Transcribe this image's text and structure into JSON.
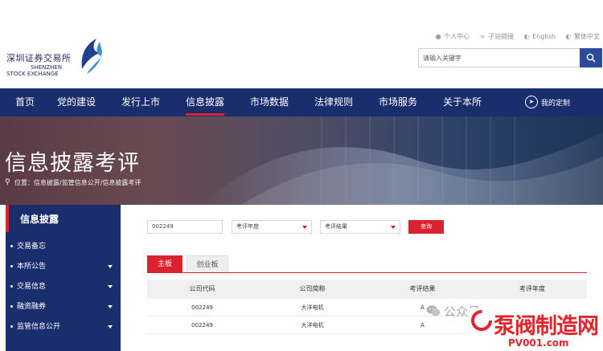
{
  "header": {
    "logo_cn": "深圳证券交易所",
    "logo_en_1": "SHENZHEN",
    "logo_en_2": "STOCK EXCHANGE",
    "toplinks": [
      {
        "label": "个人中心",
        "icon": "user-icon"
      },
      {
        "label": "子站链接",
        "icon": "link-icon"
      },
      {
        "label": "English",
        "icon": "globe-icon"
      },
      {
        "label": "繁体中文",
        "icon": "globe-icon"
      }
    ],
    "search_placeholder": "请输入关键字"
  },
  "nav": {
    "items": [
      "首页",
      "党的建设",
      "发行上市",
      "信息披露",
      "市场数据",
      "法律规则",
      "市场服务",
      "关于本所"
    ],
    "active": "信息披露",
    "custom_label": "我的定制"
  },
  "banner": {
    "title": "信息披露考评",
    "breadcrumb": "位置：信息披露/监管信息公开/信息披露考评"
  },
  "sidebar": {
    "title": "信息披露",
    "items": [
      {
        "label": "交易备忘",
        "has_arrow": false
      },
      {
        "label": "本所公告",
        "has_arrow": true
      },
      {
        "label": "交易信息",
        "has_arrow": true
      },
      {
        "label": "融资融券",
        "has_arrow": true
      },
      {
        "label": "监管信息公开",
        "has_arrow": true
      }
    ]
  },
  "filters": {
    "code_value": "002249",
    "year_label": "考评年度",
    "result_label": "考评结果",
    "query_label": "查询"
  },
  "tabs": [
    "主板",
    "创业板"
  ],
  "table": {
    "headers": [
      "公司代码",
      "公司简称",
      "考评结果",
      "考评年度"
    ],
    "rows": [
      [
        "002249",
        "大洋电机",
        "A",
        ""
      ],
      [
        "002249",
        "大洋电机",
        "A",
        ""
      ]
    ]
  },
  "watermark": {
    "wechat_text": "公众号",
    "logo_text": "泵阀制造网",
    "logo_url": "PV001.com"
  },
  "colors": {
    "brand_navy": "#1a2d6c",
    "accent_red": "#d9232e"
  }
}
